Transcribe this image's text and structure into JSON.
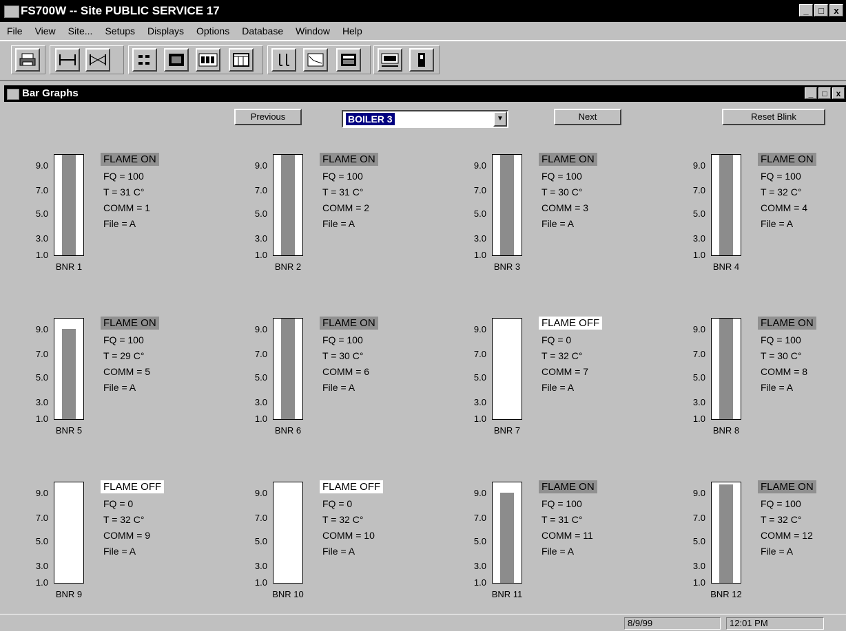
{
  "window": {
    "title": "FS700W -- Site PUBLIC SERVICE 17",
    "btn_min": "_",
    "btn_max": "□",
    "btn_close": "x"
  },
  "menu": [
    "File",
    "View",
    "Site...",
    "Setups",
    "Displays",
    "Options",
    "Database",
    "Window",
    "Help"
  ],
  "toolbar": {
    "buttons": [
      "printer-icon",
      "sensor-icon",
      "sensor-pair-icon",
      "list-icon",
      "bitmap-icon",
      "abc-icon",
      "table-icon",
      "columns-icon",
      "trend-icon",
      "calculator-icon",
      "ok-icon",
      "battery-icon"
    ]
  },
  "doc": {
    "title": "Bar Graphs",
    "btn_min": "_",
    "btn_max": "□",
    "btn_close": "x"
  },
  "controls": {
    "previous": "Previous",
    "boiler": "BOILER 3",
    "next": "Next",
    "reset_blink": "Reset Blink"
  },
  "ticks": [
    "9.0",
    "7.0",
    "5.0",
    "3.0",
    "1.0"
  ],
  "burners": [
    {
      "name": "BNR 1",
      "status": "FLAME ON",
      "on": true,
      "fq": "FQ = 100",
      "t": "T = 31 C°",
      "comm": "COMM = 1",
      "file": "File = A",
      "level": 10.0
    },
    {
      "name": "BNR 2",
      "status": "FLAME ON",
      "on": true,
      "fq": "FQ = 100",
      "t": "T = 31 C°",
      "comm": "COMM = 2",
      "file": "File = A",
      "level": 10.0
    },
    {
      "name": "BNR 3",
      "status": "FLAME ON",
      "on": true,
      "fq": "FQ = 100",
      "t": "T = 30 C°",
      "comm": "COMM = 3",
      "file": "File = A",
      "level": 10.0
    },
    {
      "name": "BNR 4",
      "status": "FLAME ON",
      "on": true,
      "fq": "FQ = 100",
      "t": "T = 32 C°",
      "comm": "COMM = 4",
      "file": "File = A",
      "level": 10.0
    },
    {
      "name": "BNR 5",
      "status": "FLAME ON",
      "on": true,
      "fq": "FQ = 100",
      "t": "T = 29 C°",
      "comm": "COMM = 5",
      "file": "File = A",
      "level": 9.0
    },
    {
      "name": "BNR 6",
      "status": "FLAME ON",
      "on": true,
      "fq": "FQ = 100",
      "t": "T = 30 C°",
      "comm": "COMM = 6",
      "file": "File = A",
      "level": 10.0
    },
    {
      "name": "BNR 7",
      "status": "FLAME OFF",
      "on": false,
      "fq": "FQ = 0",
      "t": "T = 32 C°",
      "comm": "COMM = 7",
      "file": "File = A",
      "level": 0
    },
    {
      "name": "BNR 8",
      "status": "FLAME ON",
      "on": true,
      "fq": "FQ = 100",
      "t": "T = 30 C°",
      "comm": "COMM = 8",
      "file": "File = A",
      "level": 10.0
    },
    {
      "name": "BNR 9",
      "status": "FLAME OFF",
      "on": false,
      "fq": "FQ = 0",
      "t": "T = 32 C°",
      "comm": "COMM = 9",
      "file": "File = A",
      "level": 0
    },
    {
      "name": "BNR 10",
      "status": "FLAME OFF",
      "on": false,
      "fq": "FQ = 0",
      "t": "T = 32 C°",
      "comm": "COMM = 10",
      "file": "File = A",
      "level": 0
    },
    {
      "name": "BNR 11",
      "status": "FLAME ON",
      "on": true,
      "fq": "FQ = 100",
      "t": "T = 31 C°",
      "comm": "COMM = 11",
      "file": "File = A",
      "level": 9.0
    },
    {
      "name": "BNR 12",
      "status": "FLAME ON",
      "on": true,
      "fq": "FQ = 100",
      "t": "T = 32 C°",
      "comm": "COMM = 12",
      "file": "File = A",
      "level": 9.8
    }
  ],
  "status": {
    "date": "8/9/99",
    "time": "12:01 PM"
  }
}
